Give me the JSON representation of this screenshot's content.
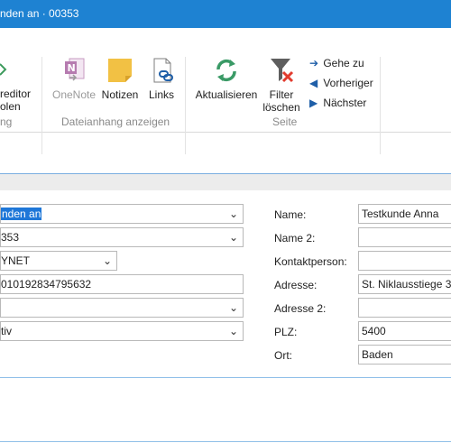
{
  "window": {
    "title": "nden an · 00353"
  },
  "ribbon": {
    "kreditor_button": {
      "line1": "reditor",
      "line2": "olen"
    },
    "group_partial_label": "ng",
    "onenote_button": "OneNote",
    "notizen_button": "Notizen",
    "links_button": "Links",
    "dateianhang_group_label": "Dateianhang anzeigen",
    "aktualisieren_button": "Aktualisieren",
    "filter_button": {
      "line1": "Filter",
      "line2": "löschen"
    },
    "gehe_zu_button": "Gehe zu",
    "vorheriger_button": "Vorheriger",
    "naechster_button": "Nächster",
    "seite_group_label": "Seite"
  },
  "form_left": {
    "field1_value": "nden an",
    "field2_value": "353",
    "field3_value": "YNET",
    "field4_value": "010192834795632",
    "field5_value": "",
    "field6_value": "tiv"
  },
  "form_right": {
    "name_label": "Name:",
    "name_value": "Testkunde Anna",
    "name2_label": "Name 2:",
    "name2_value": "",
    "kontakt_label": "Kontaktperson:",
    "kontakt_value": "",
    "adresse_label": "Adresse:",
    "adresse_value": "St. Niklausstiege 3",
    "adresse2_label": "Adresse 2:",
    "adresse2_value": "",
    "plz_label": "PLZ:",
    "plz_value": "5400",
    "ort_label": "Ort:",
    "ort_value": "Baden"
  },
  "icons": {
    "refresh": "refresh-icon",
    "filter_clear": "filter-clear-icon",
    "onenote": "onenote-icon",
    "notes": "notes-icon",
    "links": "links-icon"
  },
  "colors": {
    "titlebar": "#1e82d2",
    "accent": "#1e77d8"
  }
}
